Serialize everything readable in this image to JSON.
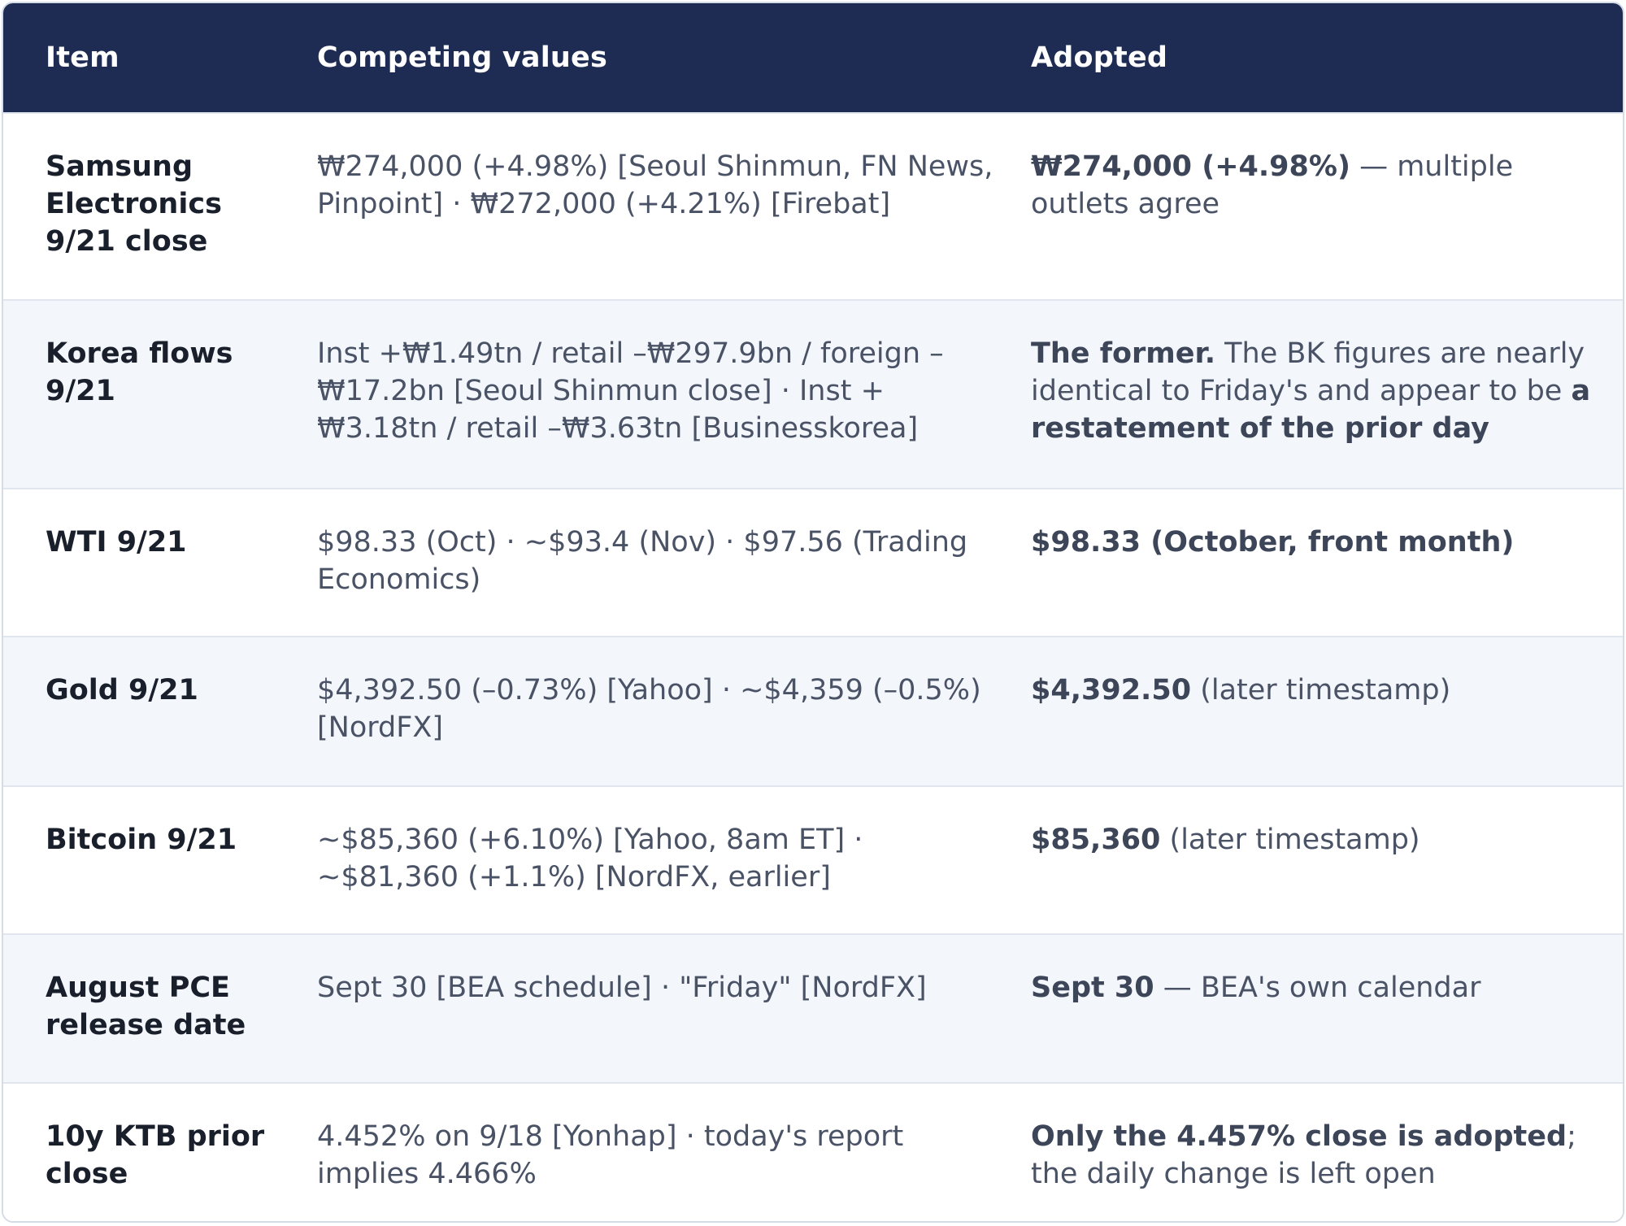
{
  "table": {
    "headers": {
      "item": "Item",
      "competing": "Competing values",
      "adopted": "Adopted"
    },
    "rows": [
      {
        "item": "Samsung Electronics 9/21 close",
        "competing": "₩274,000 (+4.98%) [Seoul Shinmun, FN News, Pinpoint] · ₩272,000 (+4.21%) [Firebat]",
        "adopted_bold_1": "₩274,000 (+4.98%)",
        "adopted_text_1": " — multiple outlets agree",
        "adopted_bold_2": "",
        "adopted_text_2": ""
      },
      {
        "item": "Korea flows 9/21",
        "competing": "Inst +₩1.49tn / retail –₩297.9bn / foreign –₩17.2bn [Seoul Shinmun close] · Inst +₩3.18tn / retail –₩3.63tn [Businesskorea]",
        "adopted_bold_1": "The former.",
        "adopted_text_1": " The BK figures are nearly identical to Friday's and appear to be ",
        "adopted_bold_2": "a restatement of the prior day",
        "adopted_text_2": ""
      },
      {
        "item": "WTI 9/21",
        "competing": "$98.33 (Oct) · ~$93.4 (Nov) · $97.56 (Trading Economics)",
        "adopted_bold_1": "$98.33 (October, front month)",
        "adopted_text_1": "",
        "adopted_bold_2": "",
        "adopted_text_2": ""
      },
      {
        "item": "Gold 9/21",
        "competing": "$4,392.50 (–0.73%) [Yahoo] · ~$4,359 (–0.5%) [NordFX]",
        "adopted_bold_1": "$4,392.50",
        "adopted_text_1": " (later timestamp)",
        "adopted_bold_2": "",
        "adopted_text_2": ""
      },
      {
        "item": "Bitcoin 9/21",
        "competing": "~$85,360 (+6.10%) [Yahoo, 8am ET] · ~$81,360 (+1.1%) [NordFX, earlier]",
        "adopted_bold_1": "$85,360",
        "adopted_text_1": " (later timestamp)",
        "adopted_bold_2": "",
        "adopted_text_2": ""
      },
      {
        "item": "August PCE release date",
        "competing": "Sept 30 [BEA schedule] · \"Friday\" [NordFX]",
        "adopted_bold_1": "Sept 30",
        "adopted_text_1": " — BEA's own calendar",
        "adopted_bold_2": "",
        "adopted_text_2": ""
      },
      {
        "item": "10y KTB prior close",
        "competing": "4.452% on 9/18 [Yonhap] · today's report implies 4.466%",
        "adopted_bold_1": "Only the 4.457% close is adopted",
        "adopted_text_1": "; the daily change is left open",
        "adopted_bold_2": "",
        "adopted_text_2": ""
      }
    ]
  }
}
